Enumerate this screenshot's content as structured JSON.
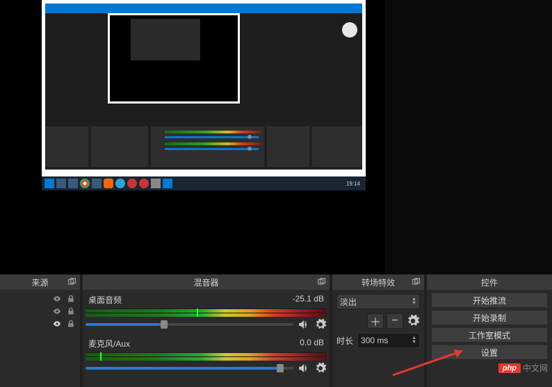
{
  "preview": {
    "taskbar_time": "19:14"
  },
  "sources": {
    "title": "来源"
  },
  "mixer": {
    "title": "混音器",
    "channels": [
      {
        "name": "桌面音频",
        "db": "-25.1 dB",
        "slider_pct": 36
      },
      {
        "name": "麦克风/Aux",
        "db": "0.0 dB",
        "slider_pct": 92
      }
    ]
  },
  "transitions": {
    "title": "转场特效",
    "selected": "淡出",
    "duration_label": "时长",
    "duration_value": "300 ms"
  },
  "controls": {
    "title": "控件",
    "buttons": [
      "开始推流",
      "开始录制",
      "工作室模式",
      "设置"
    ]
  },
  "watermark": {
    "badge": "php",
    "label": "中文网"
  }
}
